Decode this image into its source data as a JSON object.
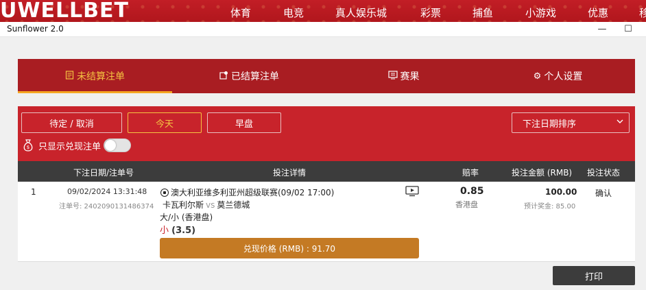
{
  "site": {
    "logo": "UWELLBET",
    "nav": [
      "体育",
      "电竞",
      "真人娱乐城",
      "彩票",
      "捕鱼",
      "小游戏",
      "优惠",
      "移"
    ]
  },
  "window": {
    "title": "Sunflower 2.0",
    "minimize": "—",
    "maximize": "☐"
  },
  "tabs": [
    {
      "label": "未结算注单",
      "icon": "document-icon",
      "active": true
    },
    {
      "label": "已结算注单",
      "icon": "settled-icon",
      "active": false
    },
    {
      "label": "赛果",
      "icon": "scoreboard-icon",
      "active": false
    },
    {
      "label": "个人设置",
      "icon": "gear-icon",
      "active": false
    }
  ],
  "filters": {
    "buttons": [
      "待定 / 取消",
      "今天",
      "早盘"
    ],
    "active": "今天",
    "sort_label": "下注日期排序",
    "cashout_only_label": "只显示兑现注单",
    "cashout_only_on": false
  },
  "table": {
    "headers": [
      "下注日期/注单号",
      "投注详情",
      "赔率",
      "投注金额 (RMB)",
      "投注状态"
    ]
  },
  "bet": {
    "index": "1",
    "date": "09/02/2024 13:31:48",
    "order_no": "注单号: 2402090131486374",
    "league": "澳大利亚维多利亚州超级联赛(09/02 17:00)",
    "home": "卡瓦利尔斯",
    "vs": "vs",
    "away": "莫兰德城",
    "market": "大/小 (香港盘)",
    "selection": "小",
    "line": "(3.5)",
    "odds": "0.85",
    "odds_format": "香港盘",
    "stake": "100.00",
    "potential_payout": "预计奖金: 85.00",
    "status": "确认",
    "cashout_label": "兑现价格 (RMB) : 91.70"
  },
  "print_label": "打印"
}
